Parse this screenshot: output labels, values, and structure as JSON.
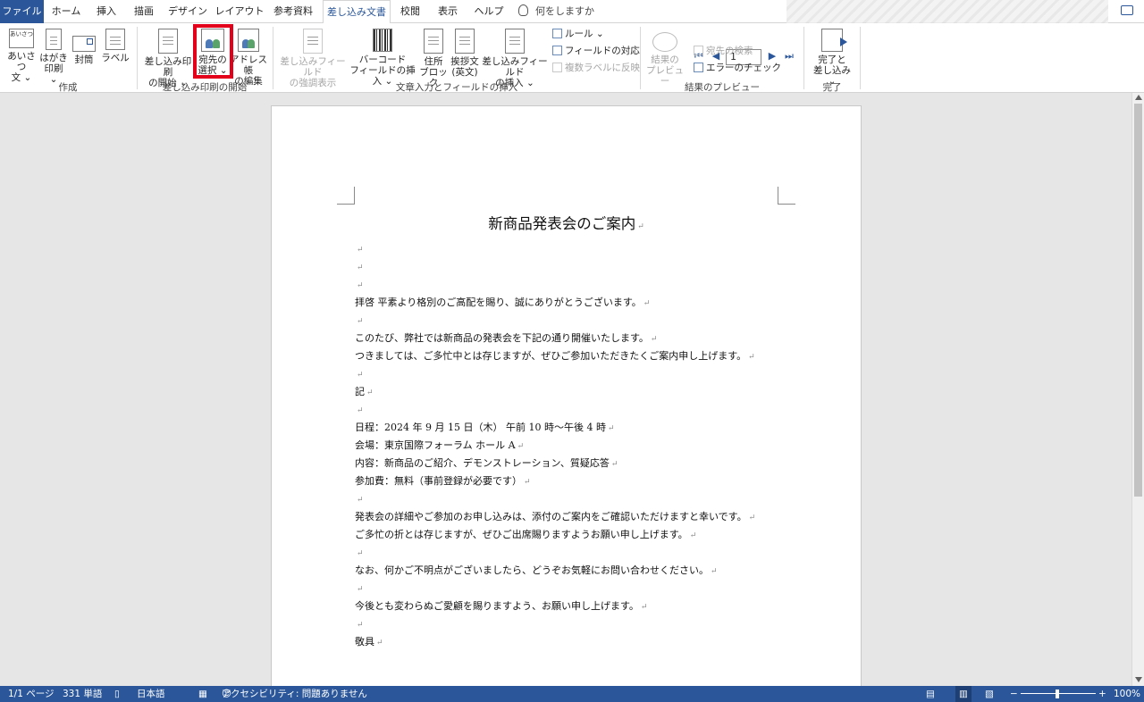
{
  "tabs": {
    "file": "ファイル",
    "home": "ホーム",
    "insert": "挿入",
    "draw": "描画",
    "design": "デザイン",
    "layout": "レイアウト",
    "references": "参考資料",
    "mailings": "差し込み文書",
    "review": "校閲",
    "view": "表示",
    "help": "ヘルプ"
  },
  "tell_me": "何をしますか",
  "ribbon": {
    "create": {
      "label": "作成",
      "greeting": [
        "あいさつ",
        "文 ⌄"
      ],
      "postcard": [
        "はがき",
        "印刷 ⌄"
      ],
      "envelope": "封筒",
      "labels": "ラベル",
      "greeting_icon_text": "あいさつ"
    },
    "start": {
      "label": "差し込み印刷の開始",
      "start_merge": [
        "差し込み印刷",
        "の開始 ⌄"
      ],
      "select_recipients": [
        "宛先の",
        "選択 ⌄"
      ],
      "edit_list": [
        "アドレス帳",
        "の編集"
      ]
    },
    "write": {
      "label": "文章入力とフィールドの挿入",
      "highlight_fields": [
        "差し込みフィールド",
        "の強調表示"
      ],
      "barcode": [
        "バーコード",
        "フィールドの挿入 ⌄"
      ],
      "address_block": [
        "住所",
        "ブロック"
      ],
      "greeting_line": [
        "挨拶文",
        "(英文)"
      ],
      "insert_field": [
        "差し込みフィールド",
        "の挿入 ⌄"
      ],
      "rules": "ルール ⌄",
      "match_fields": "フィールドの対応",
      "update_labels": "複数ラベルに反映"
    },
    "preview": {
      "label": "結果のプレビュー",
      "preview_results": [
        "結果の",
        "プレビュー"
      ],
      "record": "1",
      "find_recipient": "宛先の検索",
      "check_errors": "エラーのチェック"
    },
    "finish": {
      "label": "完了",
      "finish_merge": [
        "完了と",
        "差し込み ⌄"
      ]
    }
  },
  "document": {
    "title": "新商品発表会のご案内",
    "paragraph_mark": "↵",
    "lines": [
      "",
      "",
      "",
      "拝啓 平素より格別のご高配を賜り、誠にありがとうございます。",
      "",
      "このたび、弊社では新商品の発表会を下記の通り開催いたします。",
      "つきましては、ご多忙中とは存じますが、ぜひご参加いただきたくご案内申し上げます。",
      "",
      "記",
      "",
      "日程：2024 年 9 月 15 日（木） 午前 10 時～午後 4 時",
      "会場：東京国際フォーラム ホール A",
      "内容：新商品のご紹介、デモンストレーション、質疑応答",
      "参加費：無料（事前登録が必要です）",
      "",
      "発表会の詳細やご参加のお申し込みは、添付のご案内をご確認いただけますと幸いです。",
      "ご多忙の折とは存じますが、ぜひご出席賜りますようお願い申し上げます。",
      "",
      "なお、何かご不明点がございましたら、どうぞお気軽にお問い合わせください。",
      "",
      "今後とも変わらぬご愛顧を賜りますよう、お願い申し上げます。",
      "",
      "敬具"
    ]
  },
  "status": {
    "page": "1/1 ページ",
    "words": "331 単語",
    "language": "日本語",
    "accessibility": "アクセシビリティ: 問題ありません",
    "zoom": "100%"
  }
}
